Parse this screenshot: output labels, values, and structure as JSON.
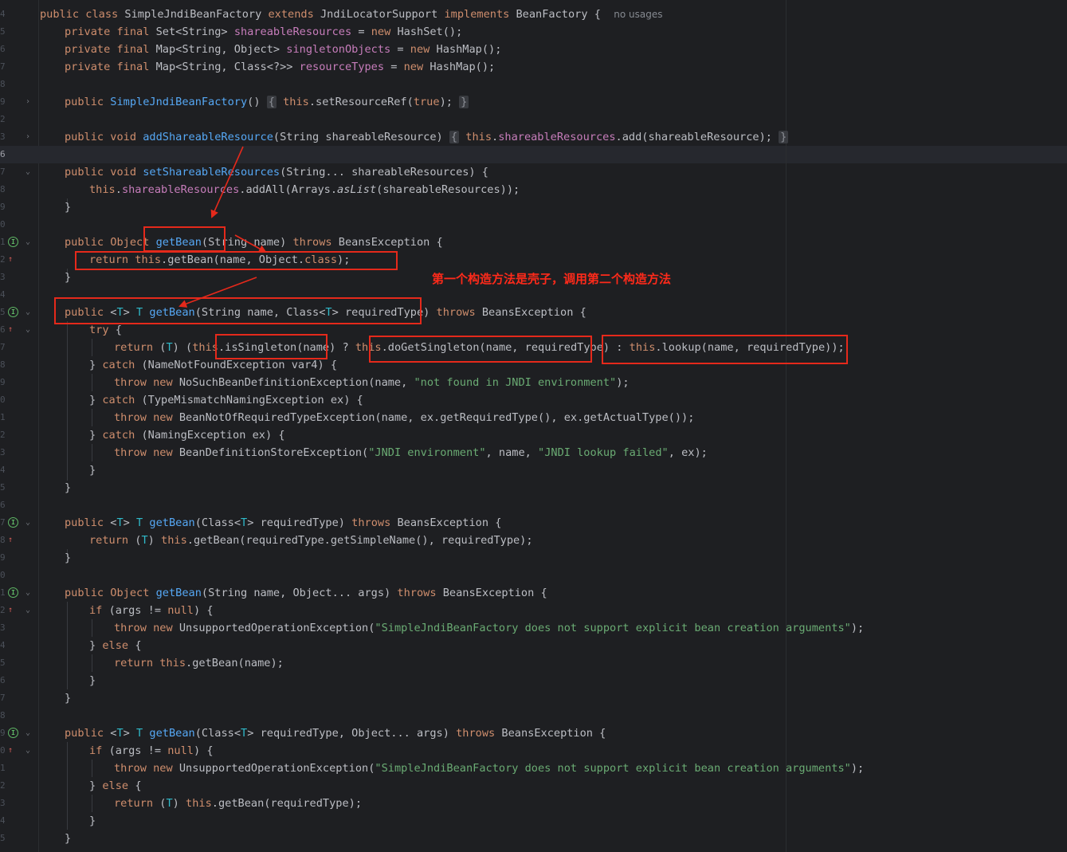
{
  "annotation": {
    "note": "第一个构造方法是壳子，调用第二个构造方法"
  },
  "gutter": {
    "line_numbers": [
      "4",
      "5",
      "6",
      "7",
      "8",
      "9",
      "2",
      "3",
      "6",
      "7",
      "8",
      "9",
      "0",
      "1",
      "2",
      "3",
      "4",
      "5",
      "6",
      "7",
      "8",
      "9",
      "0",
      "1",
      "2",
      "3",
      "4",
      "5",
      "6",
      "7",
      "8",
      "9",
      "0",
      "1",
      "2",
      "3",
      "4",
      "5",
      "6",
      "7",
      "8",
      "9",
      "0",
      "1",
      "2",
      "3",
      "4",
      "5"
    ],
    "current_line": "6"
  },
  "code": {
    "class_decl": {
      "mod": "public class",
      "name": "SimpleJndiBeanFactory",
      "ext_kw": "extends",
      "parent": "JndiLocatorSupport",
      "impl_kw": "implements",
      "iface": "BeanFactory",
      "brace": "{",
      "hint": "no usages"
    },
    "field1": {
      "mods": "private final",
      "type": "Set<String>",
      "name": "shareableResources",
      "eq": "=",
      "new": "new",
      "init": "HashSet();"
    },
    "field2": {
      "mods": "private final",
      "type": "Map<String, Object>",
      "name": "singletonObjects",
      "eq": "=",
      "new": "new",
      "init": "HashMap();"
    },
    "field3": {
      "mods": "private final",
      "type": "Map<String, Class<?>>",
      "name": "resourceTypes",
      "eq": "=",
      "new": "new",
      "init": "HashMap();"
    },
    "ctor": {
      "mod": "public",
      "name": "SimpleJndiBeanFactory",
      "params": "()",
      "open": "{",
      "this": "this",
      "body": ".setResourceRef(",
      "arg": "true",
      "end": ");",
      "close": "}"
    },
    "add_share": {
      "mods": "public void",
      "name": "addShareableResource",
      "params": "(String shareableResource)",
      "open": "{",
      "this": "this",
      "dot": ".",
      "field": "shareableResources",
      "body": ".add(shareableResource);",
      "close": "}"
    },
    "set_share": {
      "mods": "public void",
      "name": "setShareableResources",
      "params": "(String... shareableResources) {",
      "this": "this",
      "dot": ".",
      "field": "shareableResources",
      "b1": ".addAll(Arrays.",
      "aslist": "asList",
      "b2": "(shareableResources));",
      "close": "}"
    },
    "getbean1": {
      "mods": "public Object",
      "name": "getBean",
      "params": "(String name)",
      "throws": "throws",
      "exc": "BeansException {",
      "ret": "return",
      "this": "this",
      "body": ".getBean(name, Object.",
      "cls": "class",
      "end": ");",
      "close": "}"
    },
    "getbean2": {
      "mod": "public",
      "tp_open": "<",
      "T": "T",
      "tp_close": ">",
      "name": "getBean",
      "params_a": "(String name, Class<",
      "params_b": "> requiredType)",
      "throws": "throws",
      "exc": "BeansException {",
      "try": "try",
      "try_brace": "{",
      "ret": "return",
      "cast_a": "(",
      "cast_b": ") (",
      "this": "this",
      "is_single": ".isSingleton(name)",
      "q": "?",
      "do_single": ".doGetSingleton(name, requiredType)",
      "colon": ":",
      "lookup": ".lookup(name, requiredType));",
      "c1_a": "}",
      "catch": "catch",
      "c1_b": "(NameNotFoundException var4) {",
      "throw": "throw",
      "new": "new",
      "t1": "NoSuchBeanDefinitionException(name,",
      "s1": "\"not found in JNDI environment\"",
      "t1_end": ");",
      "c2_b": "(TypeMismatchNamingException ex) {",
      "t2": "BeanNotOfRequiredTypeException(name, ex.getRequiredType(), ex.getActualType());",
      "c3_b": "(NamingException ex) {",
      "t3": "BeanDefinitionStoreException(",
      "s3a": "\"JNDI environment\"",
      "t3_mid": ", name,",
      "s3b": "\"JNDI lookup failed\"",
      "t3_end": ", ex);",
      "close_inner": "}",
      "close": "}"
    },
    "getbean3": {
      "mod": "public",
      "tp_open": "<",
      "T": "T",
      "tp_close": ">",
      "name": "getBean",
      "params_a": "(Class<",
      "params_b": "> requiredType)",
      "throws": "throws",
      "exc": "BeansException {",
      "ret": "return",
      "cast_a": "(",
      "cast_b": ")",
      "this": "this",
      "body": ".getBean(requiredType.getSimpleName(), requiredType);",
      "close": "}"
    },
    "getbean4": {
      "mods": "public Object",
      "name": "getBean",
      "params": "(String name, Object... args)",
      "throws": "throws",
      "exc": "BeansException {",
      "if": "if",
      "cond": "(args !=",
      "null": "null",
      "cond_end": ") {",
      "throw": "throw",
      "new": "new",
      "t": "UnsupportedOperationException(",
      "s": "\"SimpleJndiBeanFactory does not support explicit bean creation arguments\"",
      "t_end": ");",
      "else_a": "}",
      "else": "else",
      "else_b": "{",
      "ret": "return",
      "this": "this",
      "body": ".getBean(name);",
      "close_inner": "}",
      "close": "}"
    },
    "getbean5": {
      "mod": "public",
      "tp_open": "<",
      "T": "T",
      "tp_close": ">",
      "name": "getBean",
      "params_a": "(Class<",
      "params_b": "> requiredType, Object... args)",
      "throws": "throws",
      "exc": "BeansException {",
      "if": "if",
      "cond": "(args !=",
      "null": "null",
      "cond_end": ") {",
      "throw": "throw",
      "new": "new",
      "t": "UnsupportedOperationException(",
      "s": "\"SimpleJndiBeanFactory does not support explicit bean creation arguments\"",
      "t_end": ");",
      "else_a": "}",
      "else": "else",
      "else_b": "{",
      "ret": "return",
      "cast_a": "(",
      "cast_b": ")",
      "this": "this",
      "body": ".getBean(requiredType);",
      "close_inner": "}",
      "close": "}"
    }
  },
  "colors": {
    "keyword": "#cf8e6d",
    "function": "#56a8f5",
    "field": "#c77dbb",
    "string": "#6aab73",
    "type_param": "#2fbaca",
    "annotation": "#e5291b"
  },
  "icons": {
    "fold": "chevron-icon",
    "implements": "implementation-marker-icon"
  }
}
